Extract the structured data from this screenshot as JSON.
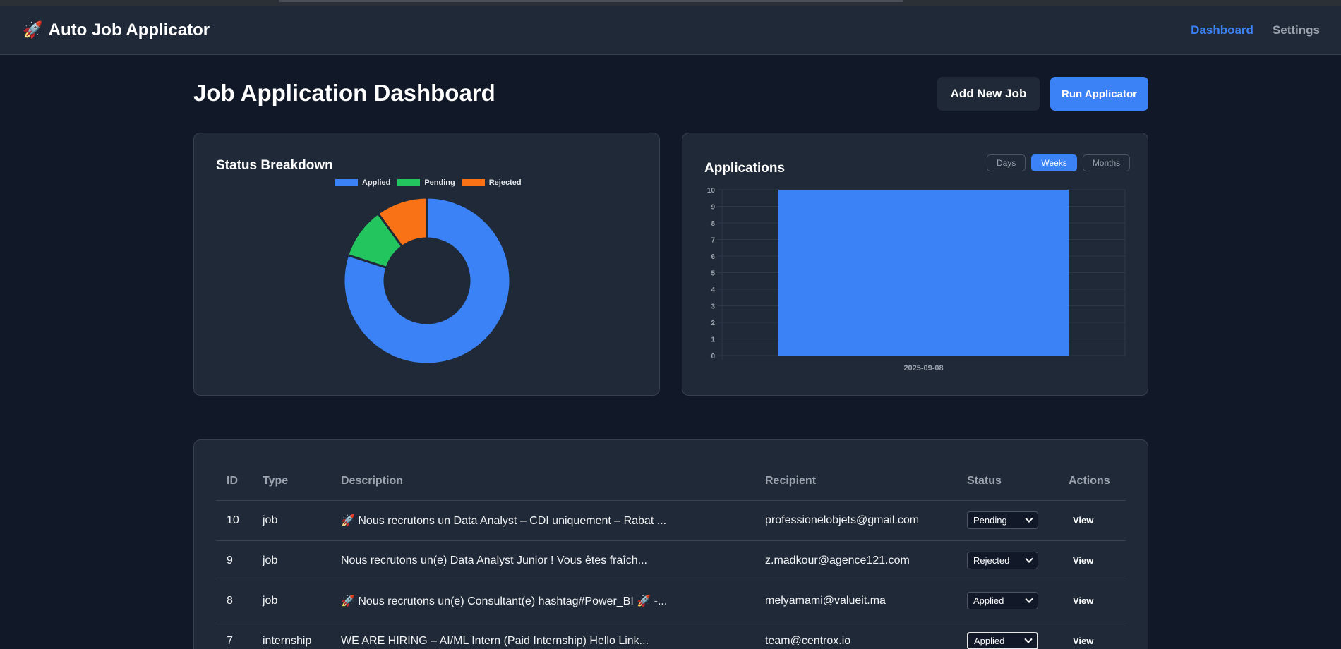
{
  "app": {
    "brand_icon": "🚀",
    "title": "Auto Job Applicator"
  },
  "nav": [
    {
      "label": "Dashboard",
      "active": true
    },
    {
      "label": "Settings",
      "active": false
    }
  ],
  "page": {
    "title": "Job Application Dashboard"
  },
  "actions": {
    "add_label": "Add New Job",
    "run_label": "Run Applicator"
  },
  "colors": {
    "applied": "#3b82f6",
    "pending": "#22c55e",
    "rejected": "#f97316"
  },
  "status_card": {
    "title": "Status Breakdown"
  },
  "applications_card": {
    "title": "Applications",
    "ranges": [
      {
        "label": "Days",
        "active": false
      },
      {
        "label": "Weeks",
        "active": true
      },
      {
        "label": "Months",
        "active": false
      }
    ]
  },
  "chart_data": [
    {
      "type": "pie",
      "variant": "doughnut",
      "title": "Status Breakdown",
      "labels": [
        "Applied",
        "Pending",
        "Rejected"
      ],
      "values": [
        8,
        1,
        1
      ],
      "legend": "top"
    },
    {
      "type": "bar",
      "title": "Applications",
      "categories": [
        "2025-09-08"
      ],
      "values": [
        10
      ],
      "ylim": [
        0,
        10
      ],
      "yticks": [
        0,
        1,
        2,
        3,
        4,
        5,
        6,
        7,
        8,
        9,
        10
      ],
      "grid": true
    }
  ],
  "table": {
    "headers": [
      "ID",
      "Type",
      "Description",
      "Recipient",
      "Status",
      "Actions"
    ],
    "rows": [
      {
        "id": "10",
        "type": "job",
        "description": "🚀 Nous recrutons un Data Analyst – CDI uniquement – Rabat ...",
        "recipient": "professionelobjets@gmail.com",
        "status": "Pending",
        "action": "View"
      },
      {
        "id": "9",
        "type": "job",
        "description": "Nous recrutons un(e) Data Analyst Junior ! Vous êtes fraîch...",
        "recipient": "z.madkour@agence121.com",
        "status": "Rejected",
        "action": "View"
      },
      {
        "id": "8",
        "type": "job",
        "description": "🚀 Nous recrutons un(e) Consultant(e) hashtag#Power_BI 🚀 -...",
        "recipient": "melyamami@valueit.ma",
        "status": "Applied",
        "action": "View"
      },
      {
        "id": "7",
        "type": "internship",
        "description": "WE ARE HIRING – AI/ML Intern (Paid Internship) Hello Link...",
        "recipient": "team@centrox.io",
        "status": "Applied",
        "action": "View"
      }
    ]
  }
}
